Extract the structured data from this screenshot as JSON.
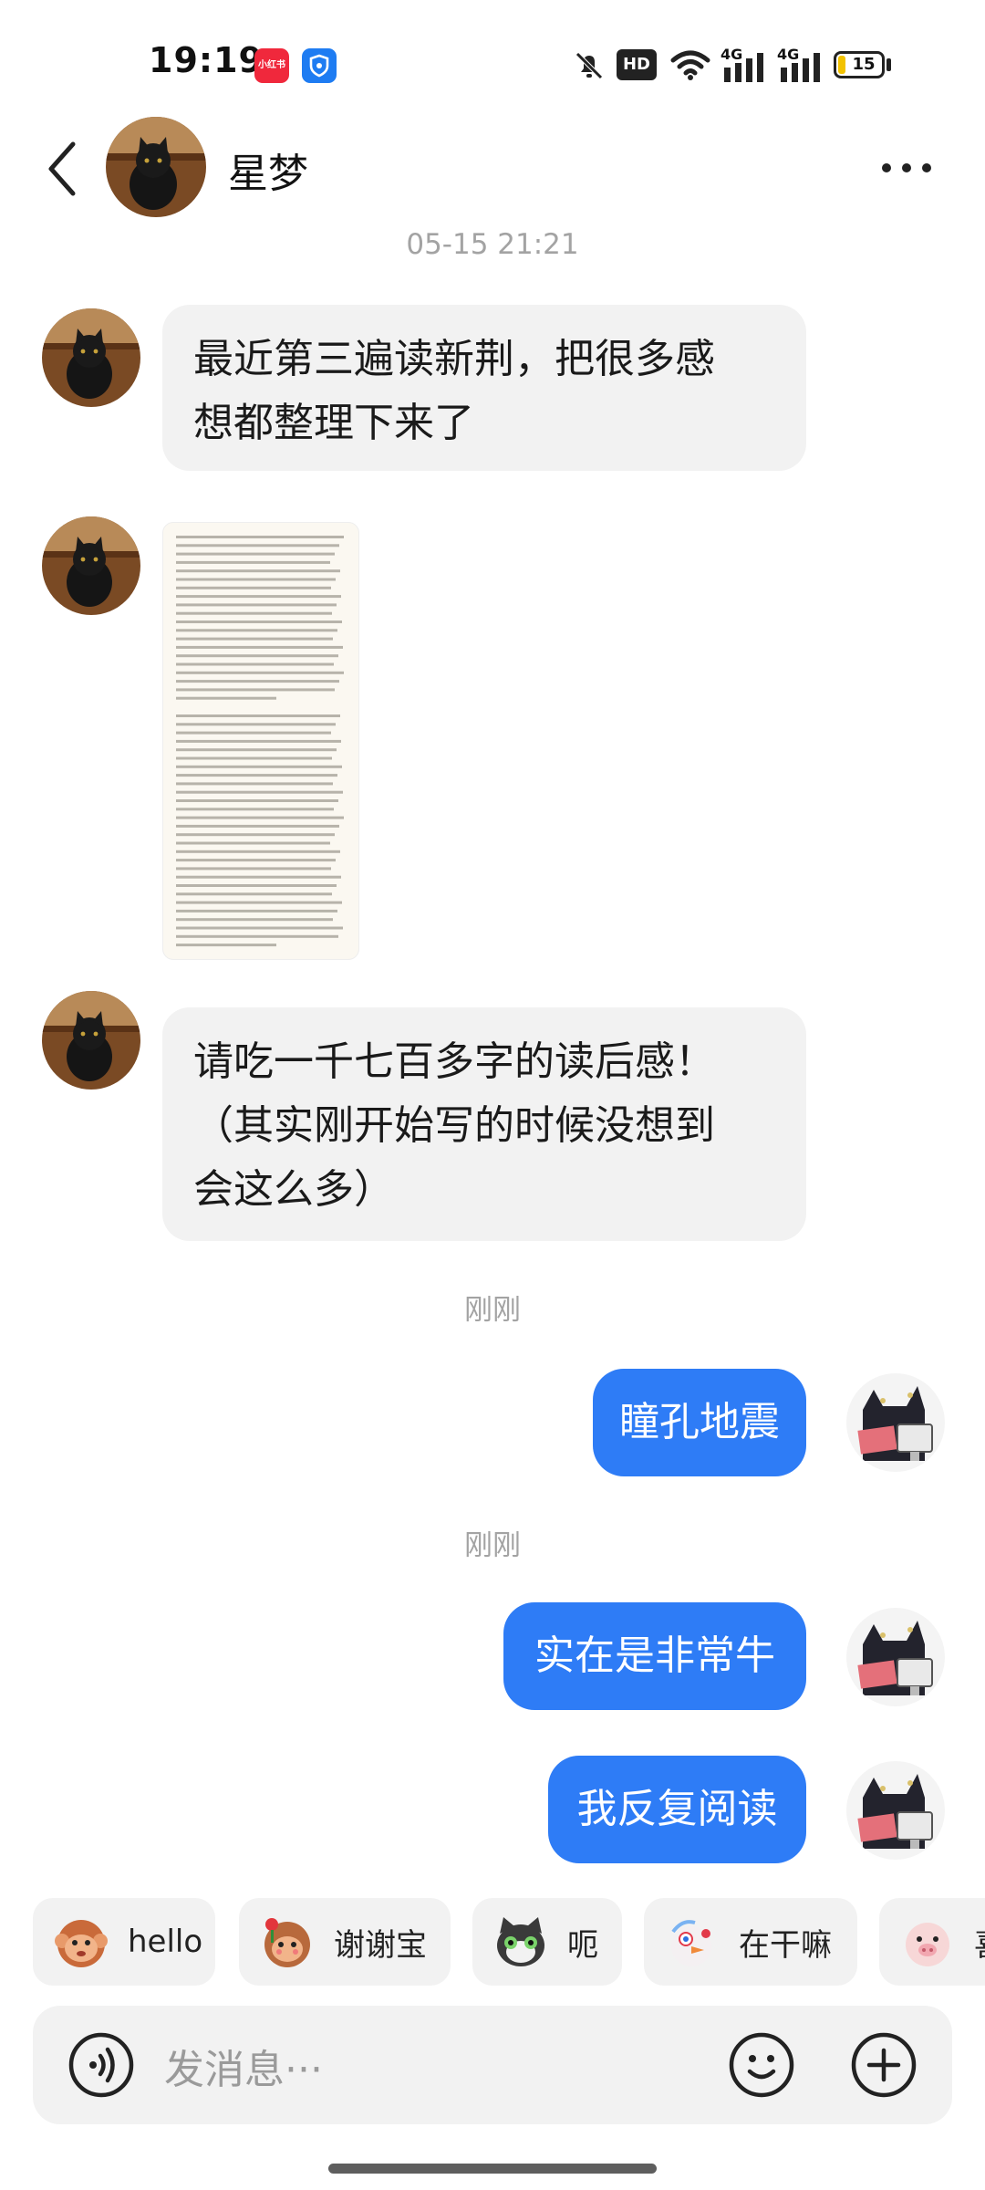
{
  "status_bar": {
    "time": "19:19",
    "app_badge_1": "小红书",
    "app_icon_2": "shield-icon",
    "icons": [
      "mute-bell-icon",
      "hd-icon",
      "wifi-icon",
      "4g-signal-icon",
      "4g-signal-icon",
      "battery-icon"
    ],
    "hd_label": "HD",
    "network_1": "4G",
    "network_2": "4G",
    "battery": "15"
  },
  "header": {
    "contact_name": "星梦"
  },
  "messages": [
    {
      "type": "timestamp",
      "text": "05-15 21:21"
    },
    {
      "type": "incoming_text",
      "text_line1": "最近第三遍读新荆，把很多感",
      "text_line2": "想都整理下来了"
    },
    {
      "type": "incoming_image",
      "image": "screenshot of document text"
    },
    {
      "type": "incoming_text",
      "text_line1": "请吃一千七百多字的读后感！",
      "text_line2": "（其实刚开始写的时候没想到",
      "text_line3": "会这么多）"
    },
    {
      "type": "timestamp",
      "text": "刚刚"
    },
    {
      "type": "outgoing_text",
      "text": "瞳孔地震"
    },
    {
      "type": "timestamp",
      "text": "刚刚"
    },
    {
      "type": "outgoing_text",
      "text": "实在是非常牛"
    },
    {
      "type": "outgoing_text",
      "text": "我反复阅读"
    }
  ],
  "quick_replies": [
    {
      "label": "hello",
      "emoji": "monkey-sticker"
    },
    {
      "label": "谢谢宝",
      "emoji": "monkey-flower-sticker"
    },
    {
      "label": "呃",
      "emoji": "cat-sticker"
    },
    {
      "label": "在干嘛",
      "emoji": "bird-sticker"
    },
    {
      "label": "喜",
      "emoji": "pig-sticker"
    }
  ],
  "input": {
    "placeholder": "发消息···",
    "left_icon": "voice-icon",
    "emoji_icon": "smiley-icon",
    "plus_icon": "plus-icon"
  },
  "colors": {
    "outgoing_bubble": "#2e7cf6",
    "incoming_bubble": "#f2f2f2",
    "timestamp": "#a3a3a3"
  }
}
